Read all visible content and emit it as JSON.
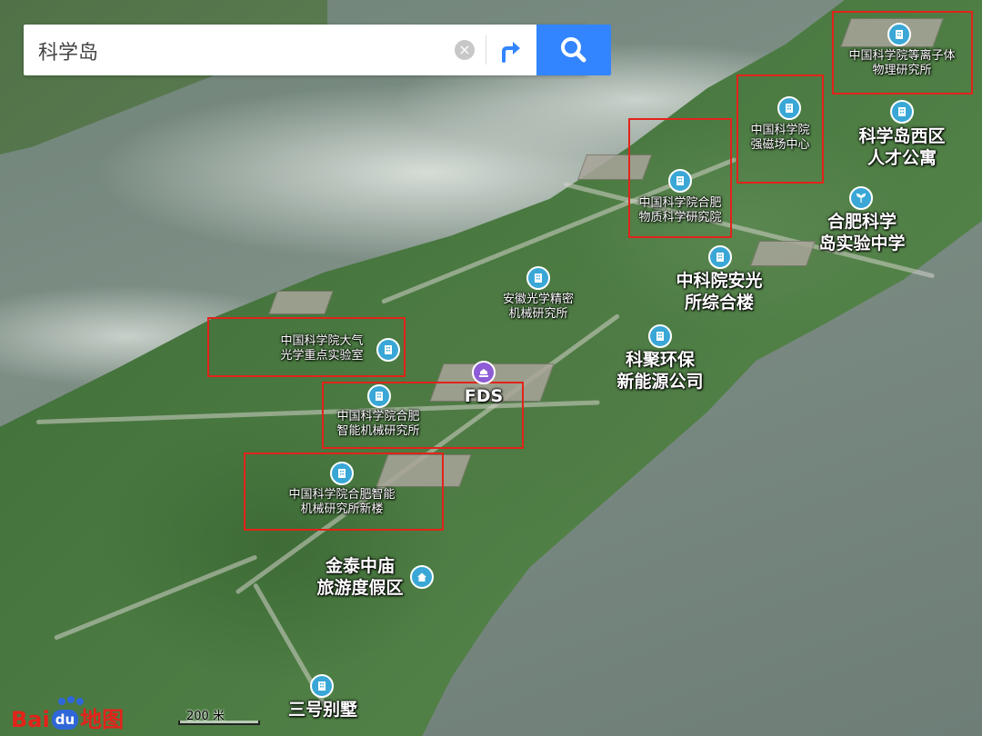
{
  "search": {
    "value": "科学岛"
  },
  "pois": [
    {
      "id": "plasma-inst",
      "label": "中国科学院等离子体\n物理研究所",
      "size": "small",
      "icon": "building-icon"
    },
    {
      "id": "mag-field",
      "label": "中国科学院\n强磁场中心",
      "size": "small",
      "icon": "building-icon"
    },
    {
      "id": "west-apt",
      "label": "科学岛西区\n人才公寓",
      "size": "big",
      "icon": "building-icon"
    },
    {
      "id": "material-inst",
      "label": "中国科学院合肥\n物质科学研究院",
      "size": "small",
      "icon": "building-icon"
    },
    {
      "id": "school",
      "label": "合肥科学\n岛实验中学",
      "size": "big",
      "icon": "school-icon"
    },
    {
      "id": "anguang",
      "label": "中科院安光\n所综合楼",
      "size": "big",
      "icon": "building-icon"
    },
    {
      "id": "optics-inst",
      "label": "安徽光学精密\n机械研究所",
      "size": "small",
      "icon": "building-icon"
    },
    {
      "id": "atmos-lab",
      "label": "中国科学院大气\n光学重点实验室",
      "size": "small",
      "icon": "building-icon"
    },
    {
      "id": "keju",
      "label": "科聚环保\n新能源公司",
      "size": "big",
      "icon": "building-icon"
    },
    {
      "id": "fds",
      "label": "FDS",
      "size": "big",
      "icon": "landmark-icon"
    },
    {
      "id": "intel-machine",
      "label": "中国科学院合肥\n智能机械研究所",
      "size": "small",
      "icon": "building-icon"
    },
    {
      "id": "intel-new",
      "label": "中国科学院合肥智能\n机械研究所新楼",
      "size": "small",
      "icon": "building-icon"
    },
    {
      "id": "resort",
      "label": "金泰中庙\n旅游度假区",
      "size": "big",
      "icon": "resort-icon"
    },
    {
      "id": "villa",
      "label": "三号别墅",
      "size": "big",
      "icon": "building-icon"
    }
  ],
  "logo": {
    "bai": "Bai",
    "du": "du",
    "ditu": "地图"
  },
  "scale": {
    "label": "200 米"
  }
}
